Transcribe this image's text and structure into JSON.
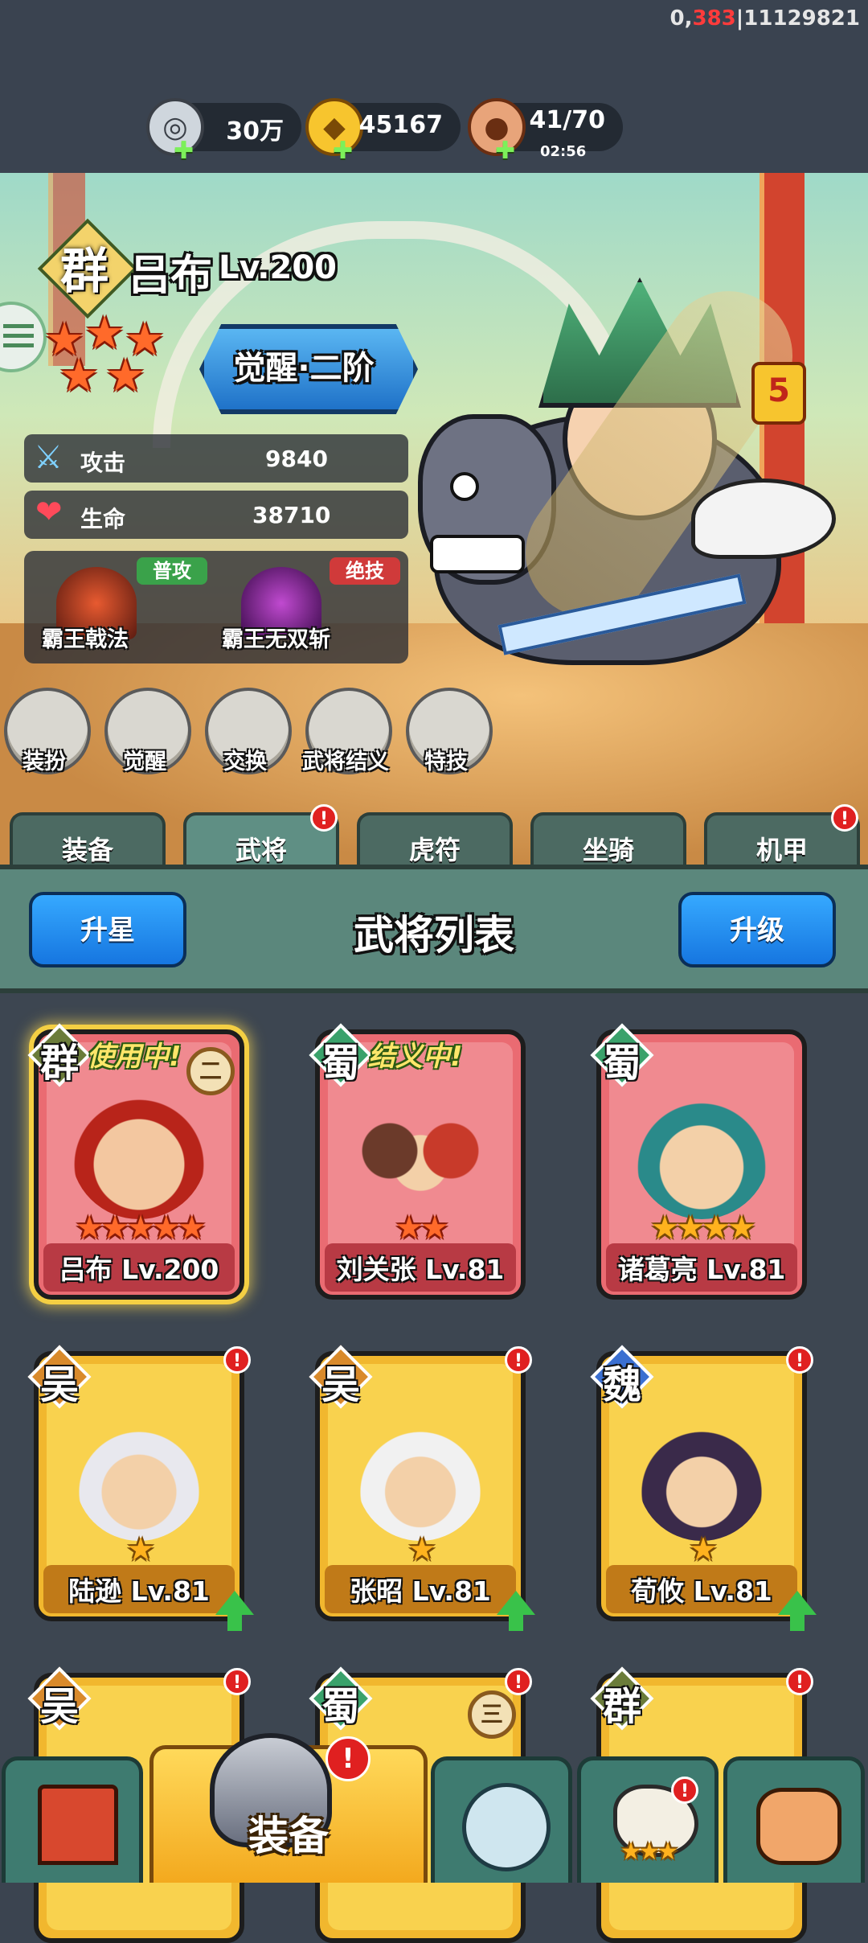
{
  "debug": {
    "prefix": "0,",
    "highlight": "383",
    "suffix": "|11129821"
  },
  "resources": {
    "silver": {
      "icon": "silver-coin-icon",
      "value": "30万"
    },
    "gold": {
      "icon": "gold-ingot-icon",
      "value": "45167"
    },
    "stamina": {
      "icon": "meat-icon",
      "value": "41/70",
      "timer": "02:56"
    }
  },
  "hero": {
    "faction": "群",
    "name": "吕布",
    "level": "Lv.200",
    "star_count": 5,
    "awaken": "觉醒·二阶",
    "stats": [
      {
        "icon": "sword-icon",
        "label": "攻击",
        "value": "9840"
      },
      {
        "icon": "heart-icon",
        "label": "生命",
        "value": "38710"
      }
    ],
    "skills": [
      {
        "tag": "普攻",
        "name": "霸王戟法",
        "tag_color": "#3aa24a"
      },
      {
        "tag": "绝技",
        "name": "霸王无双斩",
        "tag_color": "#d03a3a"
      }
    ],
    "mount_rank": "5"
  },
  "functions": [
    "装扮",
    "觉醒",
    "交换",
    "武将结义",
    "特技"
  ],
  "tabs": [
    {
      "label": "装备",
      "badge": false
    },
    {
      "label": "武将",
      "badge": true,
      "active": true
    },
    {
      "label": "虎符",
      "badge": false
    },
    {
      "label": "坐骑",
      "badge": false
    },
    {
      "label": "机甲",
      "badge": true
    }
  ],
  "badge_mark": "!",
  "list": {
    "title": "武将列表",
    "left_button": "升星",
    "right_button": "升级"
  },
  "cards": [
    {
      "faction": "群",
      "name": "吕布 Lv.200",
      "status": "使用中!",
      "rank": "二",
      "stars": "★★★★★",
      "color": "red",
      "selected": true
    },
    {
      "faction": "蜀",
      "name": "刘关张 Lv.81",
      "status": "结义中!",
      "stars": "★★",
      "color": "red"
    },
    {
      "faction": "蜀",
      "name": "诸葛亮 Lv.81",
      "stars": "★★★★",
      "color": "red"
    },
    {
      "faction": "吴",
      "name": "陆逊 Lv.81",
      "stars": "★",
      "color": "yellow",
      "badge": true,
      "upgrade": true
    },
    {
      "faction": "吴",
      "name": "张昭 Lv.81",
      "stars": "★",
      "color": "yellow",
      "badge": true,
      "upgrade": true
    },
    {
      "faction": "魏",
      "name": "荀攸 Lv.81",
      "stars": "★",
      "color": "yellow",
      "badge": true,
      "upgrade": true
    },
    {
      "faction": "吴",
      "color": "yellow",
      "badge": true
    },
    {
      "faction": "蜀",
      "color": "yellow",
      "badge": true,
      "rank": "三"
    },
    {
      "faction": "群",
      "color": "yellow",
      "badge": true
    }
  ],
  "nav": [
    {
      "icon": "city-gate-icon"
    },
    {
      "label": "装备",
      "icon": "helmet-icon",
      "active": true,
      "badge": true
    },
    {
      "icon": "crossed-swords-icon"
    },
    {
      "icon": "horn-icon",
      "badge": true,
      "stars": "★★★"
    },
    {
      "icon": "fist-upgrade-icon"
    }
  ]
}
